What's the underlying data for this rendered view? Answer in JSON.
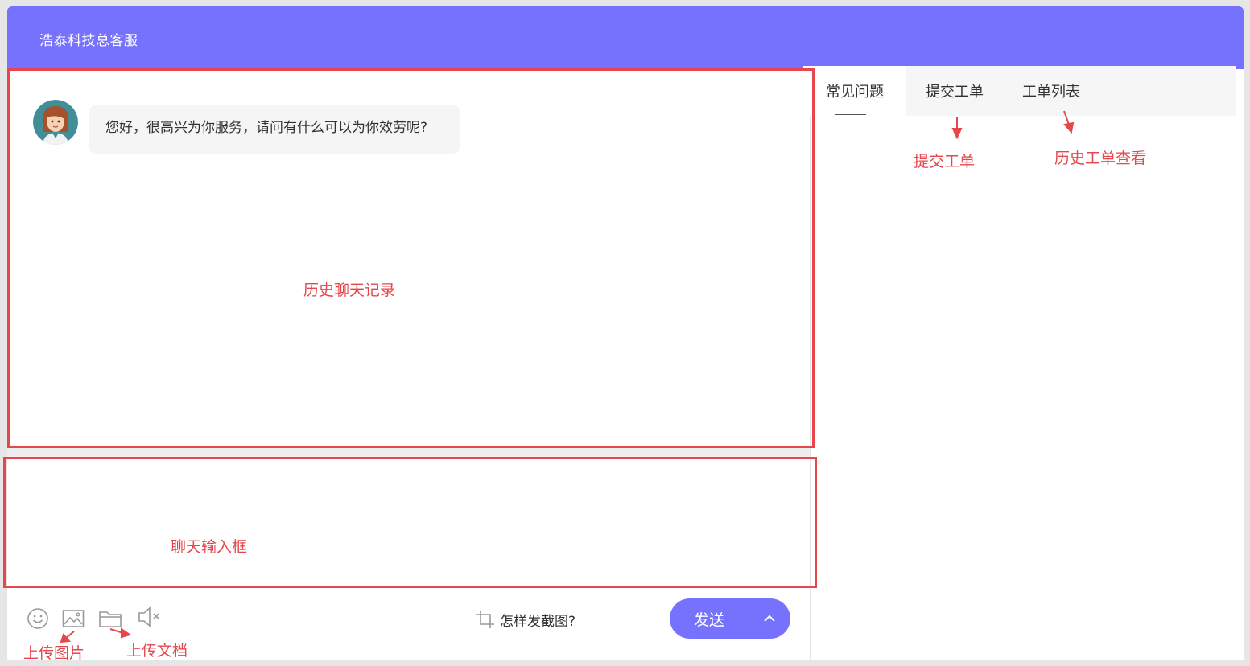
{
  "header": {
    "title": "浩泰科技总客服"
  },
  "chat": {
    "messages": [
      {
        "sender": "agent",
        "text": "您好，很高兴为你服务，请问有什么可以为你效劳呢?"
      }
    ]
  },
  "toolbar": {
    "icons": [
      "emoji-icon",
      "image-icon",
      "folder-icon",
      "speaker-muted-icon"
    ],
    "screenshot_tip": "怎样发截图?",
    "send_label": "发送"
  },
  "tabs": [
    {
      "label": "常见问题",
      "active": true
    },
    {
      "label": "提交工单",
      "active": false
    },
    {
      "label": "工单列表",
      "active": false
    }
  ],
  "annotations": {
    "history": "历史聊天记录",
    "input": "聊天输入框",
    "submit_ticket": "提交工单",
    "history_tickets": "历史工单查看",
    "upload_image": "上传图片",
    "upload_doc": "上传文档"
  },
  "colors": {
    "accent": "#7672fd",
    "annotation": "#e5474d"
  }
}
